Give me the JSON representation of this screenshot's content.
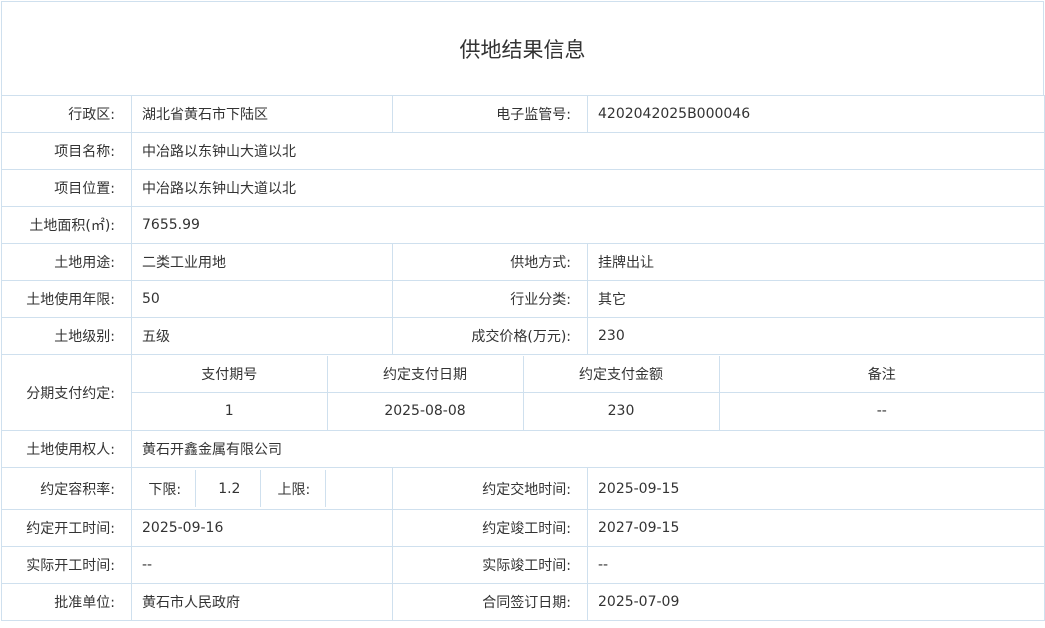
{
  "title": "供地结果信息",
  "rows": {
    "district": {
      "label": "行政区:",
      "value": "湖北省黄石市下陆区"
    },
    "supervision_no": {
      "label": "电子监管号:",
      "value": "4202042025B000046"
    },
    "project_name": {
      "label": "项目名称:",
      "value": "中冶路以东钟山大道以北"
    },
    "project_location": {
      "label": "项目位置:",
      "value": "中冶路以东钟山大道以北"
    },
    "land_area": {
      "label": "土地面积(㎡):",
      "value": "7655.99"
    },
    "land_use": {
      "label": "土地用途:",
      "value": "二类工业用地"
    },
    "supply_method": {
      "label": "供地方式:",
      "value": "挂牌出让"
    },
    "use_years": {
      "label": "土地使用年限:",
      "value": "50"
    },
    "industry": {
      "label": "行业分类:",
      "value": "其它"
    },
    "land_grade": {
      "label": "土地级别:",
      "value": "五级"
    },
    "price": {
      "label": "成交价格(万元):",
      "value": "230"
    },
    "installment": {
      "label": "分期支付约定:",
      "headers": [
        "支付期号",
        "约定支付日期",
        "约定支付金额",
        "备注"
      ],
      "rows": [
        [
          "1",
          "2025-08-08",
          "230",
          "--"
        ]
      ]
    },
    "land_user": {
      "label": "土地使用权人:",
      "value": "黄石开鑫金属有限公司"
    },
    "far": {
      "label": "约定容积率:",
      "lower_label": "下限:",
      "lower_value": "1.2",
      "upper_label": "上限:",
      "upper_value": ""
    },
    "delivery_time": {
      "label": "约定交地时间:",
      "value": "2025-09-15"
    },
    "start_time": {
      "label": "约定开工时间:",
      "value": "2025-09-16"
    },
    "completion_time": {
      "label": "约定竣工时间:",
      "value": "2027-09-15"
    },
    "actual_start": {
      "label": "实际开工时间:",
      "value": "--"
    },
    "actual_completion": {
      "label": "实际竣工时间:",
      "value": "--"
    },
    "approval_unit": {
      "label": "批准单位:",
      "value": "黄石市人民政府"
    },
    "contract_date": {
      "label": "合同签订日期:",
      "value": "2025-07-09"
    }
  }
}
